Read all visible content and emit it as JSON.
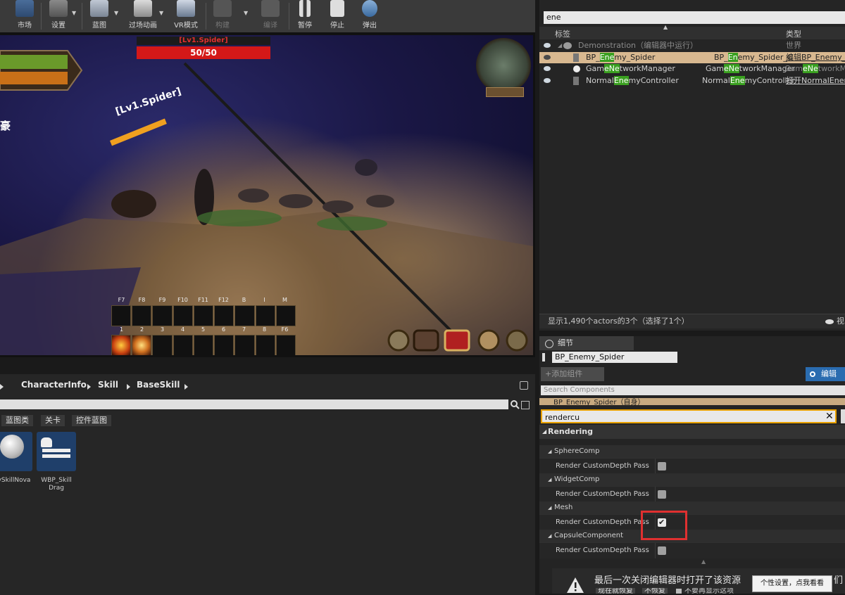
{
  "toolbar": {
    "buttons": [
      {
        "label": "市场",
        "icon": "market-icon"
      },
      {
        "label": "设置",
        "icon": "settings-icon"
      },
      {
        "label": "蓝图",
        "icon": "blueprint-icon"
      },
      {
        "label": "过场动画",
        "icon": "cinematics-icon"
      },
      {
        "label": "VR模式",
        "icon": "vr-mode-icon"
      },
      {
        "label": "构建",
        "icon": "build-icon"
      },
      {
        "label": "编译",
        "icon": "compile-icon"
      },
      {
        "label": "暂停",
        "icon": "pause-icon"
      },
      {
        "label": "停止",
        "icon": "stop-icon"
      },
      {
        "label": "弹出",
        "icon": "eject-icon"
      }
    ]
  },
  "viewport": {
    "enemy_name": "[Lv1.Spider]",
    "enemy_hp": "50/50",
    "floating_label": "[Lv1.Spider]",
    "side_text": "豪",
    "hotkeys_top": [
      "F7",
      "F8",
      "F9",
      "F10",
      "F11",
      "F12",
      "B",
      "I",
      "M"
    ],
    "hotkeys_bottom": [
      "1",
      "2",
      "3",
      "4",
      "5",
      "6",
      "7",
      "8",
      "F6"
    ]
  },
  "outliner": {
    "filter_value": "ene",
    "col_label": "标签",
    "col_type": "类型",
    "world_row": {
      "label": "Demonstration（编辑器中运行）",
      "type": "世界"
    },
    "rows": [
      {
        "pre": "BP_",
        "hl": "Ene",
        "post": "my_Spider",
        "class_pre": "BP_",
        "class_hl": "En",
        "class_post": "emy_Spider_C",
        "type": "编辑BP_Enemy_S"
      },
      {
        "pre": "Gam",
        "hl": "eNe",
        "post": "tworkManager",
        "class_pre": "Gam",
        "class_hl": "eNe",
        "class_post": "tworkManager",
        "type_pre": "Gam",
        "type_hl": "eNe",
        "type_post": "tworkMan"
      },
      {
        "pre": "Normal",
        "hl": "Ene",
        "post": "myController",
        "class_pre": "Normal",
        "class_hl": "Ene",
        "class_post": "myController",
        "type": "打开NormalEnem"
      }
    ],
    "status": "显示1,490个actors的3个（选择了1个）",
    "view_options": "视"
  },
  "details": {
    "tab_label": "细节",
    "name_field": "BP_Enemy_Spider",
    "add_component": "+添加组件",
    "edit_blueprint": "编辑",
    "search_components_placeholder": "Search Components",
    "self_row": "BP_Enemy_Spider（自身）",
    "property_filter": "rendercu",
    "category": "Rendering",
    "groups": [
      {
        "name": "SphereComp",
        "prop": "Render CustomDepth Pass",
        "checked": false
      },
      {
        "name": "WidgetComp",
        "prop": "Render CustomDepth Pass",
        "checked": false
      },
      {
        "name": "Mesh",
        "prop": "Render CustomDepth Pass",
        "checked": true
      },
      {
        "name": "CapsuleComponent",
        "prop": "Render CustomDepth Pass",
        "checked": false
      }
    ],
    "notice_text": "最后一次关闭编辑器时打开了该资源",
    "notice_tail": "们",
    "notice_btn1": "现在就恢复",
    "notice_btn2": "不恢复",
    "notice_check": "不要再显示这项",
    "tooltip": "个性设置，点我看看"
  },
  "content": {
    "breadcrumbs": [
      "CharacterInfo",
      "Skill",
      "BaseSkill"
    ],
    "filters": [
      "蓝图类",
      "关卡",
      "控件蓝图"
    ],
    "assets": [
      {
        "label": "ySkillNova"
      },
      {
        "label": "WBP_Skill\nDrag"
      }
    ]
  }
}
